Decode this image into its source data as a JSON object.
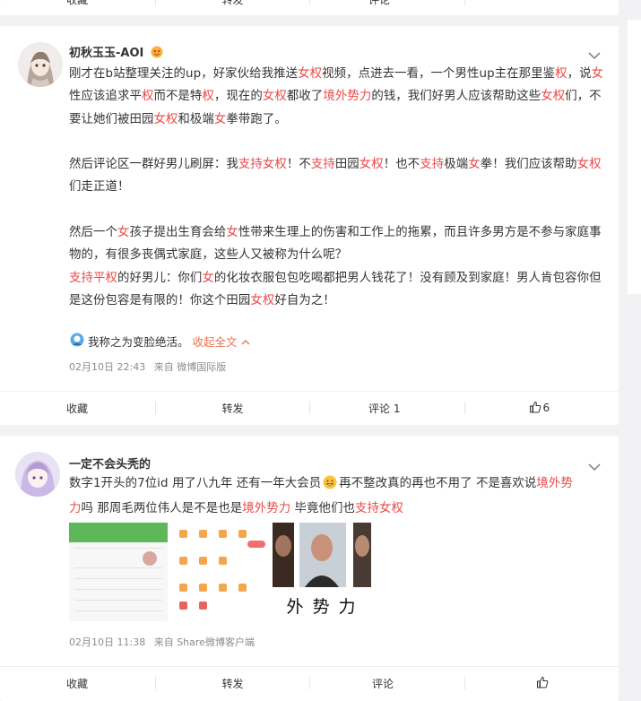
{
  "top_actions": {
    "collect": "收藏",
    "repost": "转发",
    "comment": "评论",
    "like": ""
  },
  "post1": {
    "username": "初秋玉玉-AOI",
    "paragraphs": [
      [
        {
          "t": "刚才在b站整理关注的up，好家伙给我推送"
        },
        {
          "t": "女权",
          "hl": true
        },
        {
          "t": "视频，点进去一看，一个男性up主在那里鉴"
        },
        {
          "t": "权",
          "hl": true
        },
        {
          "t": "，说"
        },
        {
          "t": "女",
          "hl": true
        },
        {
          "t": "性应该追求平"
        },
        {
          "t": "权",
          "hl": true
        },
        {
          "t": "而不是特"
        },
        {
          "t": "权",
          "hl": true
        },
        {
          "t": "，现在的"
        },
        {
          "t": "女权",
          "hl": true
        },
        {
          "t": "都收了"
        },
        {
          "t": "境外势力",
          "hl": true
        },
        {
          "t": "的钱，我们好男人应该帮助这些"
        },
        {
          "t": "女权",
          "hl": true
        },
        {
          "t": "们，不要让她们被田园"
        },
        {
          "t": "女权",
          "hl": true
        },
        {
          "t": "和极端"
        },
        {
          "t": "女",
          "hl": true
        },
        {
          "t": "拳带跑了。"
        }
      ],
      [
        {
          "t": "然后评论区一群好男儿刷屏：我"
        },
        {
          "t": "支持女权",
          "hl": true
        },
        {
          "t": "！不"
        },
        {
          "t": "支持",
          "hl": true
        },
        {
          "t": "田园"
        },
        {
          "t": "女权",
          "hl": true
        },
        {
          "t": "！也不"
        },
        {
          "t": "支持",
          "hl": true
        },
        {
          "t": "极端"
        },
        {
          "t": "女",
          "hl": true
        },
        {
          "t": "拳！我们应该帮助"
        },
        {
          "t": "女权",
          "hl": true
        },
        {
          "t": "们走正道！"
        }
      ],
      [
        {
          "t": "然后一个"
        },
        {
          "t": "女",
          "hl": true
        },
        {
          "t": "孩子提出生育会给"
        },
        {
          "t": "女",
          "hl": true
        },
        {
          "t": "性带来生理上的伤害和工作上的拖累，而且许多男方是不参与家庭事物的，有很多丧偶式家庭，这些人又被称为什么呢？"
        }
      ],
      [
        {
          "t": "支持平权",
          "hl": true
        },
        {
          "t": "的好男儿：你们"
        },
        {
          "t": "女",
          "hl": true
        },
        {
          "t": "的化妆衣服包包吃喝都把男人钱花了！没有顾及到家庭！男人肯包容你但是这份包容是有限的！你这个田园"
        },
        {
          "t": "女权",
          "hl": true
        },
        {
          "t": "好自为之！"
        }
      ]
    ],
    "source_line": "我称之为变脸绝活。",
    "collapse": "收起全文",
    "timestamp": "02月10日 22:43",
    "via": "来自 微博国际版",
    "actions": {
      "collect": "收藏",
      "repost": "转发",
      "comment": "评论 1",
      "like": "6"
    }
  },
  "post2": {
    "username": "一定不会头秃的",
    "text": [
      {
        "t": "数字1开头的7位id 用了八九年 还有一年大会员"
      },
      {
        "t": "EMOJI"
      },
      {
        "t": "再不整改真的再也不用了 不是喜欢说"
      },
      {
        "t": "境外势力",
        "hl": true
      },
      {
        "t": "吗 那周毛两位伟人是不是也是"
      },
      {
        "t": "境外势力",
        "hl": true
      },
      {
        "t": " 毕竟他们也"
      },
      {
        "t": "支持女权",
        "hl": true
      }
    ],
    "image_caption": "外 势 力",
    "timestamp": "02月10日 11:38",
    "via": "来自 Share微博客户端",
    "actions": {
      "collect": "收藏",
      "repost": "转发",
      "comment": "评论",
      "like": ""
    }
  }
}
